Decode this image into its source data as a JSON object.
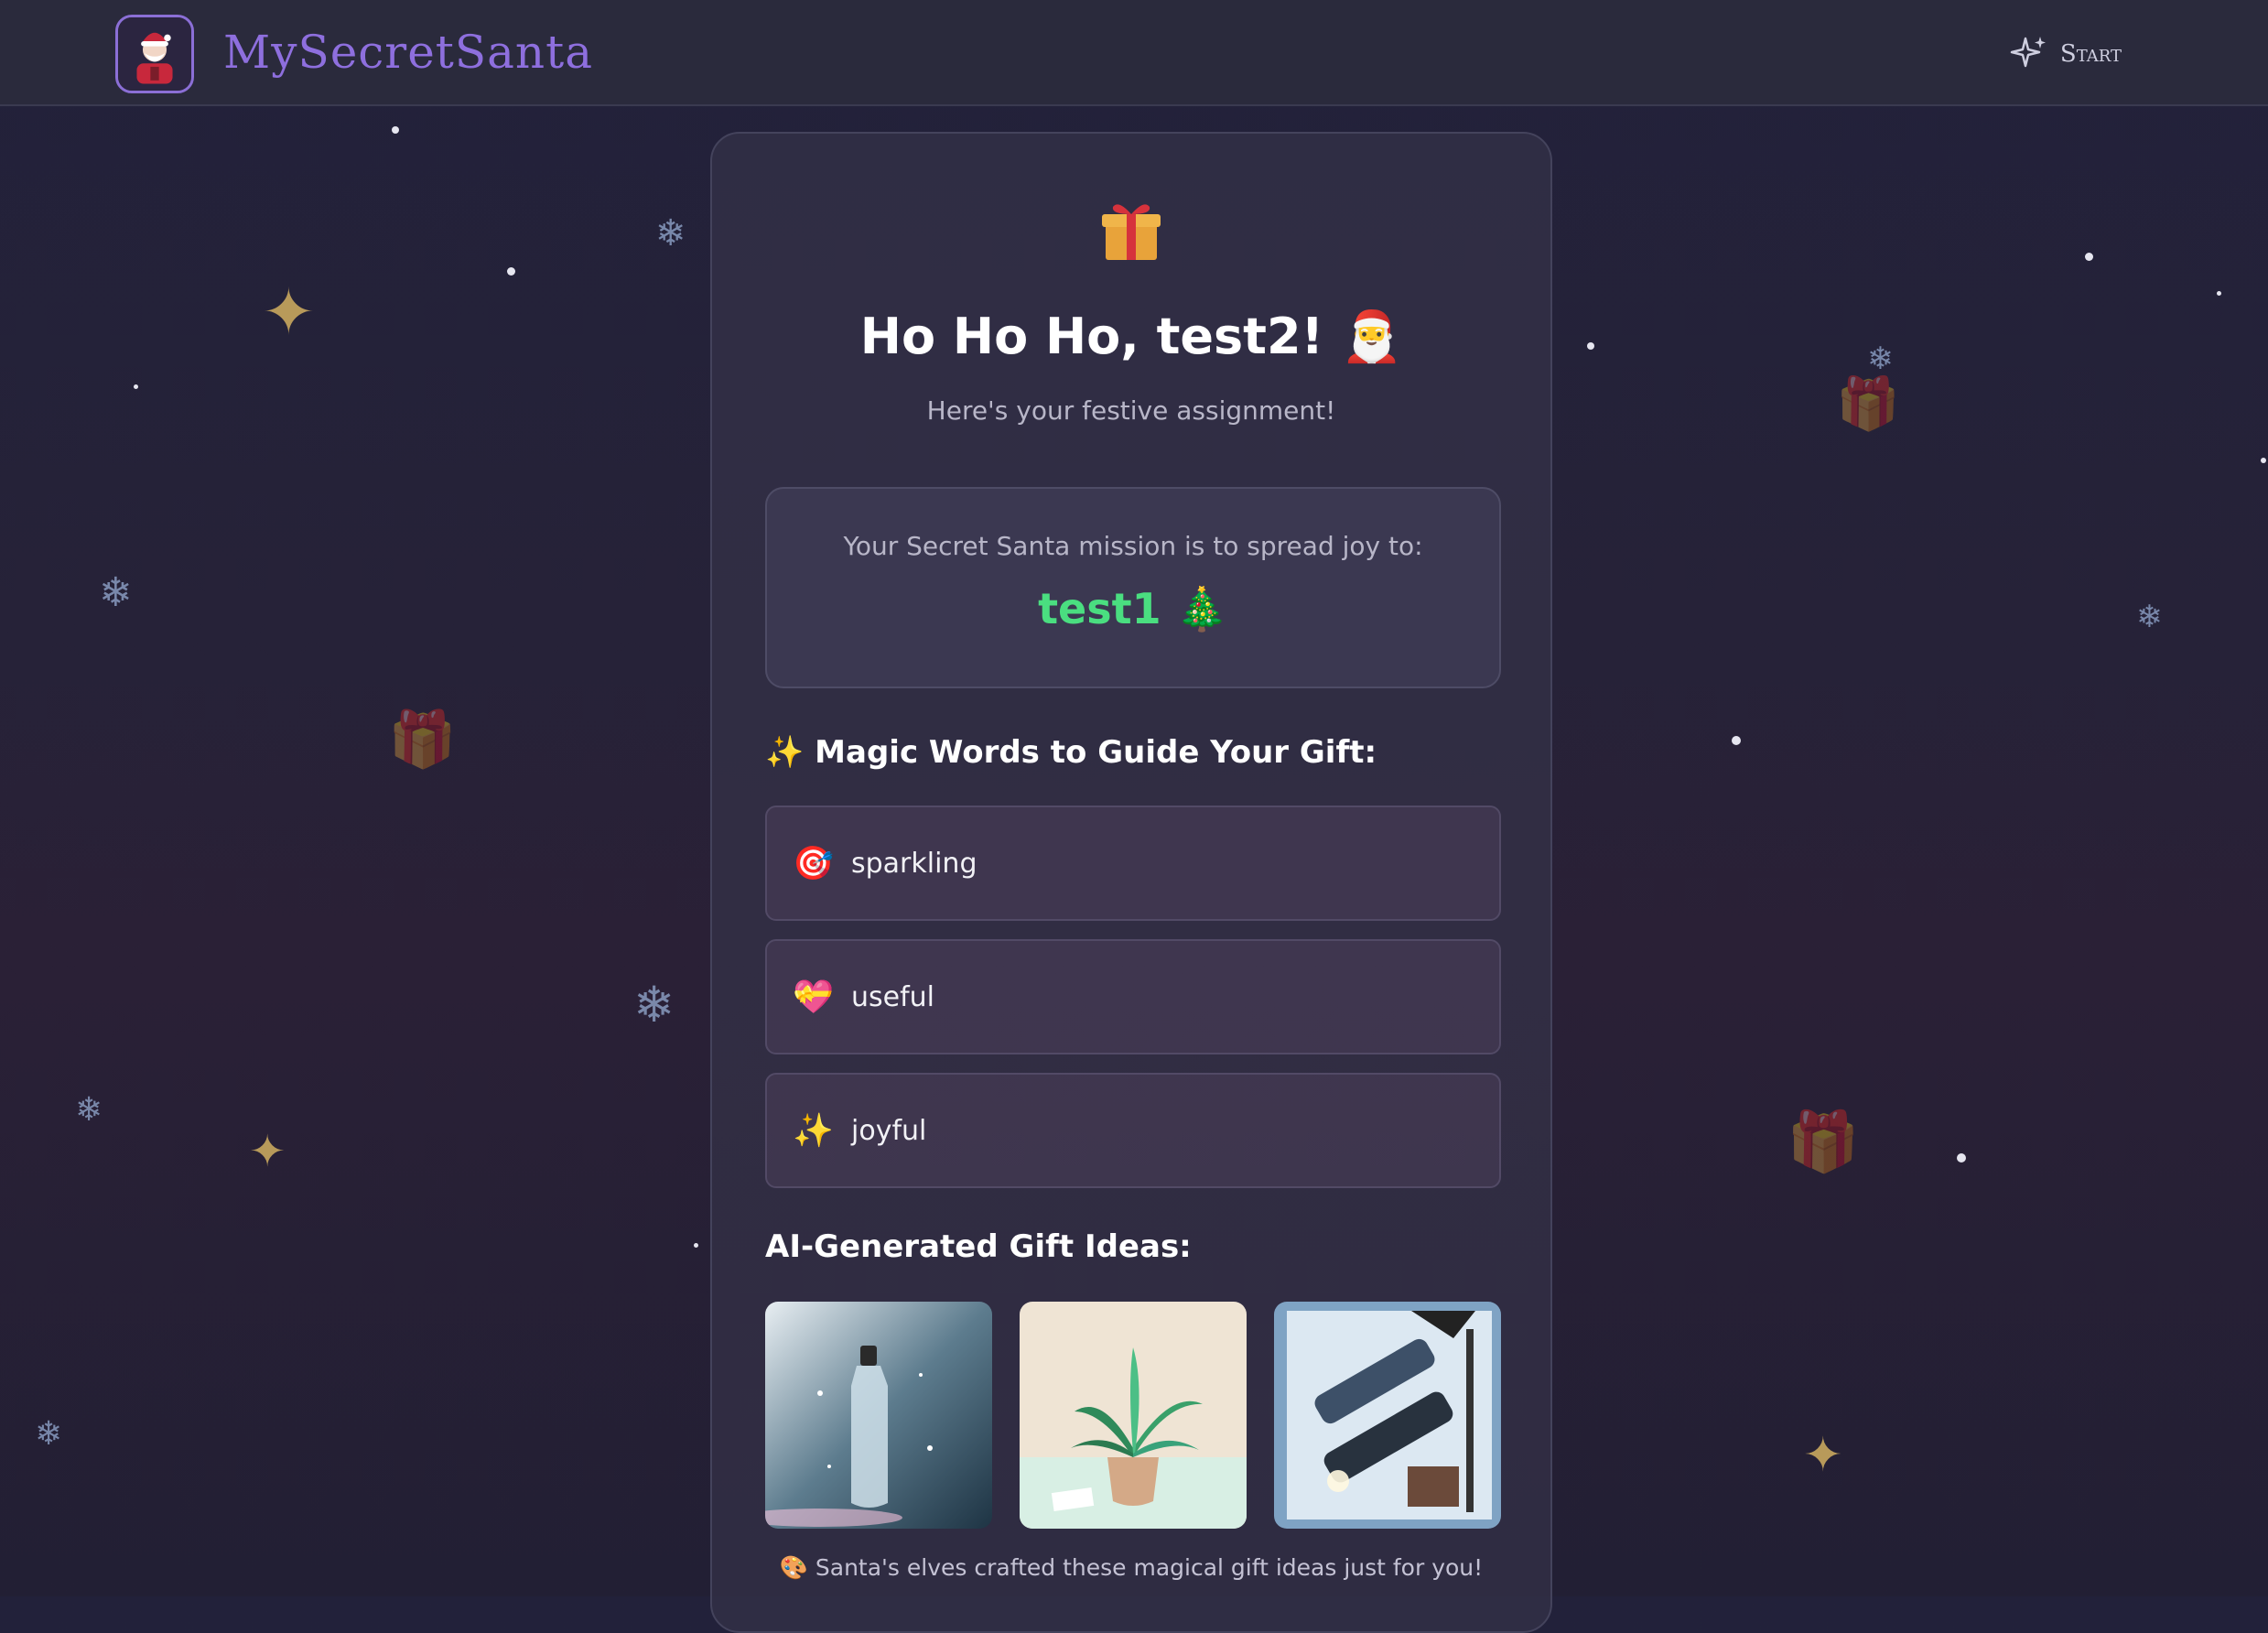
{
  "header": {
    "brand": "MySecretSanta",
    "start_label": "Start"
  },
  "assignment": {
    "greeting": "Ho Ho Ho, test2! 🎅",
    "subtitle": "Here's your festive assignment!",
    "mission_label": "Your Secret Santa mission is to spread joy to:",
    "recipient": "test1 🎄"
  },
  "magic_words": {
    "title": "✨ Magic Words to Guide Your Gift:",
    "items": [
      {
        "icon": "🎯",
        "word": "sparkling"
      },
      {
        "icon": "💝",
        "word": "useful"
      },
      {
        "icon": "✨",
        "word": "joyful"
      }
    ]
  },
  "gift_ideas": {
    "title": "AI-Generated Gift Ideas:",
    "images": [
      "sparkling-water-bottle",
      "potted-plant",
      "multi-tool"
    ],
    "footnote": "🎨 Santa's elves crafted these magical gift ideas just for you!"
  },
  "colors": {
    "accent": "#8e6fde",
    "recipient": "#4ade80",
    "background": "#24213a"
  }
}
